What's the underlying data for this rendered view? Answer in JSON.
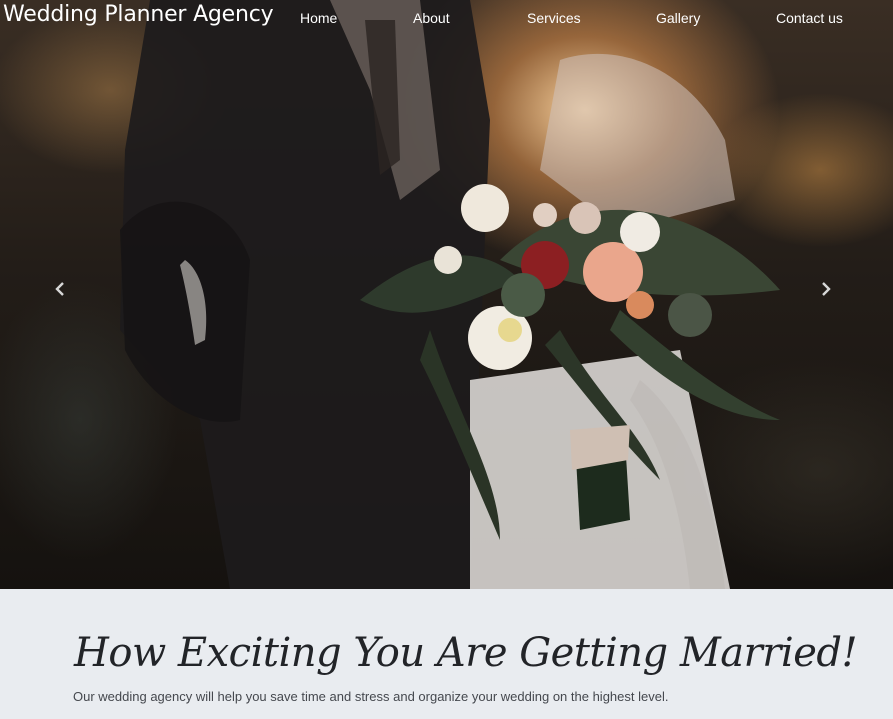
{
  "site": {
    "brand": "Wedding Planner Agency"
  },
  "nav": {
    "home": "Home",
    "about": "About",
    "services": "Services",
    "gallery": "Gallery",
    "contact": "Contact us"
  },
  "carousel": {
    "prev_icon": "chevron-left-icon",
    "next_icon": "chevron-right-icon",
    "image": "bride-and-groom-with-bouquet-photo"
  },
  "intro": {
    "heading": "How Exciting You Are Getting Married!",
    "text": "Our wedding agency will help you save time and stress and organize your wedding on the highest level."
  },
  "colors": {
    "nav_text": "#ffffff",
    "section_bg": "#e9ecf0",
    "heading": "#222428",
    "body_text": "#45484e"
  }
}
